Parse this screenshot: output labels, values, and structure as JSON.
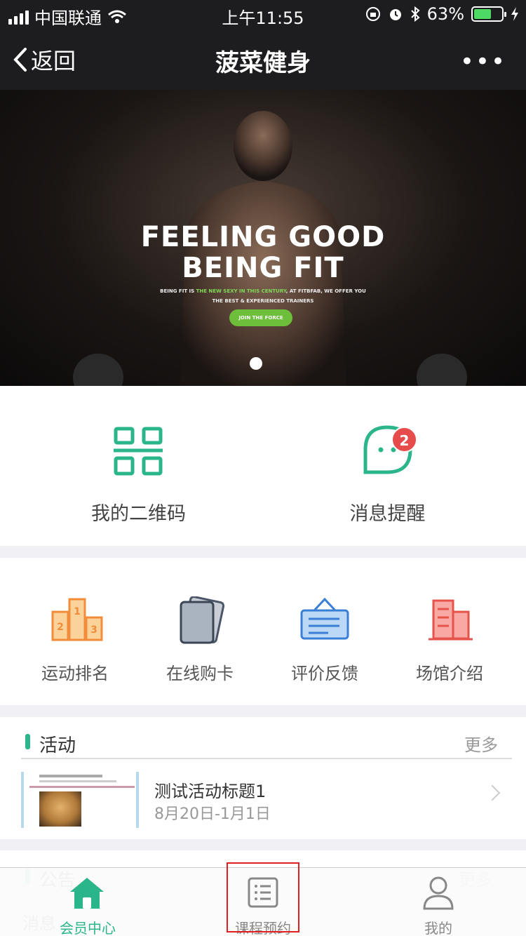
{
  "status_bar": {
    "carrier": "中国联通",
    "time": "上午11:55",
    "battery_percent": "63%",
    "battery_level": 0.63
  },
  "nav": {
    "back_label": "返回",
    "title": "菠菜健身",
    "more_label": "•••"
  },
  "banner": {
    "headline_line1": "FEELING GOOD",
    "headline_line2": "BEING FIT",
    "sub_line1_pre": "BEING FIT IS ",
    "sub_line1_accent": "THE NEW SEXY IN THIS CENTURY",
    "sub_line1_post": ", AT FITBFAB, WE OFFER YOU",
    "sub_line2": "THE BEST & EXPERIENCED TRAINERS",
    "cta": "JOIN THE FORCE",
    "active_slide": 1,
    "slide_count": 1
  },
  "quick_actions": [
    {
      "label": "我的二维码",
      "icon": "qr-code-icon"
    },
    {
      "label": "消息提醒",
      "icon": "message-bubble-icon",
      "badge": "2"
    }
  ],
  "features": [
    {
      "label": "运动排名",
      "icon": "podium-ranking-icon"
    },
    {
      "label": "在线购卡",
      "icon": "cards-icon"
    },
    {
      "label": "评价反馈",
      "icon": "feedback-sign-icon"
    },
    {
      "label": "场馆介绍",
      "icon": "building-icon"
    }
  ],
  "activities": {
    "title": "活动",
    "more": "更多",
    "items": [
      {
        "title": "测试活动标题1",
        "date": "8月20日-1月1日"
      }
    ]
  },
  "announcements": {
    "title": "公告",
    "more": "更多",
    "subtitle": "消息"
  },
  "tab_bar": {
    "tabs": [
      {
        "label": "会员中心",
        "icon": "home-icon",
        "active": true
      },
      {
        "label": "课程预约",
        "icon": "list-icon",
        "active": false
      },
      {
        "label": "我的",
        "icon": "person-icon",
        "active": false
      }
    ]
  },
  "colors": {
    "accent": "#2bb58a",
    "badge": "#e74c4c",
    "nav_bg": "#1d1d1f",
    "highlight_box": "#e02020"
  }
}
